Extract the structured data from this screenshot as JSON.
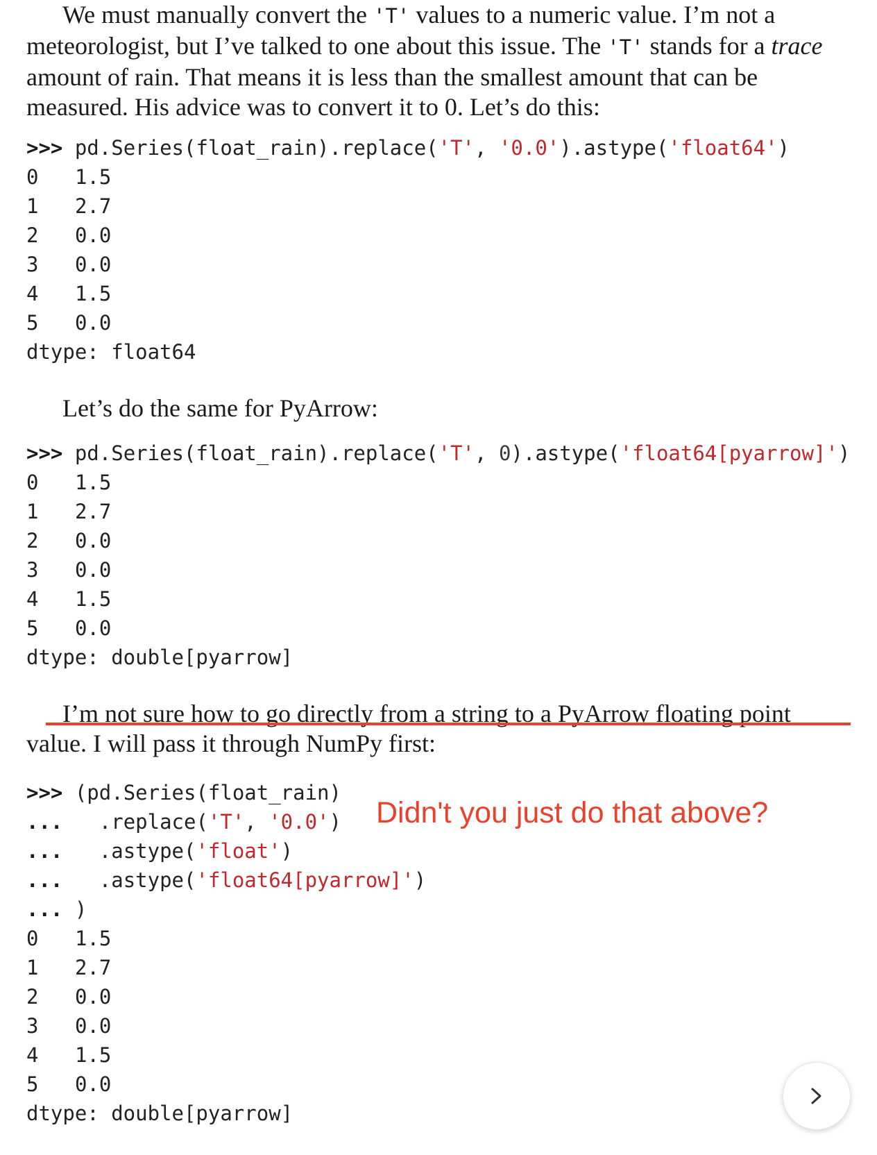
{
  "paragraph1": {
    "part1": "We must manually convert the ",
    "code1": "'T'",
    "part2": " values to a numeric value. I’m not a meteorologist, but I’ve talked to one about this issue. The ",
    "code2": "'T'",
    "part3": " stands for a ",
    "emph": "trace",
    "part4": " amount of rain. That means it is less than the smallest amount that can be measured. His advice was to convert it to 0. Let’s do this:"
  },
  "code1": {
    "prompt": ">>>",
    "pre": " pd.Series(float_rain).replace(",
    "arg1": "'T'",
    "comma": ", ",
    "arg2": "'0.0'",
    "mid": ").astype(",
    "arg3": "'float64'",
    "end": ")"
  },
  "output1": {
    "rows": [
      {
        "index": "0",
        "value": "1.5"
      },
      {
        "index": "1",
        "value": "2.7"
      },
      {
        "index": "2",
        "value": "0.0"
      },
      {
        "index": "3",
        "value": "0.0"
      },
      {
        "index": "4",
        "value": "1.5"
      },
      {
        "index": "5",
        "value": "0.0"
      }
    ],
    "dtype": "dtype: float64"
  },
  "paragraph2": "Let’s do the same for PyArrow:",
  "code2": {
    "prompt": ">>>",
    "pre": " pd.Series(float_rain).replace(",
    "arg1": "'T'",
    "comma": ", ",
    "arg2": "0",
    "mid": ").astype(",
    "arg3": "'float64[pyarrow]'",
    "end": ")"
  },
  "output2": {
    "rows": [
      {
        "index": "0",
        "value": "1.5"
      },
      {
        "index": "1",
        "value": "2.7"
      },
      {
        "index": "2",
        "value": "0.0"
      },
      {
        "index": "3",
        "value": "0.0"
      },
      {
        "index": "4",
        "value": "1.5"
      },
      {
        "index": "5",
        "value": "0.0"
      }
    ],
    "dtype": "dtype: double[pyarrow]"
  },
  "paragraph3": {
    "line1": "I’m not sure how to go directly from a string to a PyArrow floating point",
    "line2": "value. I will pass it through NumPy first:"
  },
  "code3": {
    "l1_prompt": ">>>",
    "l1_text": " (pd.Series(float_rain)",
    "l2_prompt": "...",
    "l2_pre": "   .replace(",
    "l2_arg1": "'T'",
    "l2_comma": ", ",
    "l2_arg2": "'0.0'",
    "l2_end": ")",
    "l3_prompt": "...",
    "l3_pre": "   .astype(",
    "l3_arg": "'float'",
    "l3_end": ")",
    "l4_prompt": "...",
    "l4_pre": "   .astype(",
    "l4_arg": "'float64[pyarrow]'",
    "l4_end": ")",
    "l5_prompt": "...",
    "l5_text": " )"
  },
  "output3": {
    "rows": [
      {
        "index": "0",
        "value": "1.5"
      },
      {
        "index": "1",
        "value": "2.7"
      },
      {
        "index": "2",
        "value": "0.0"
      },
      {
        "index": "3",
        "value": "0.0"
      },
      {
        "index": "4",
        "value": "1.5"
      },
      {
        "index": "5",
        "value": "0.0"
      }
    ],
    "dtype": "dtype: double[pyarrow]"
  },
  "annotation": {
    "note": "Didn't you just do that above?",
    "color": "#e8412c"
  },
  "nav": {
    "next_icon": "chevron-right-icon"
  }
}
